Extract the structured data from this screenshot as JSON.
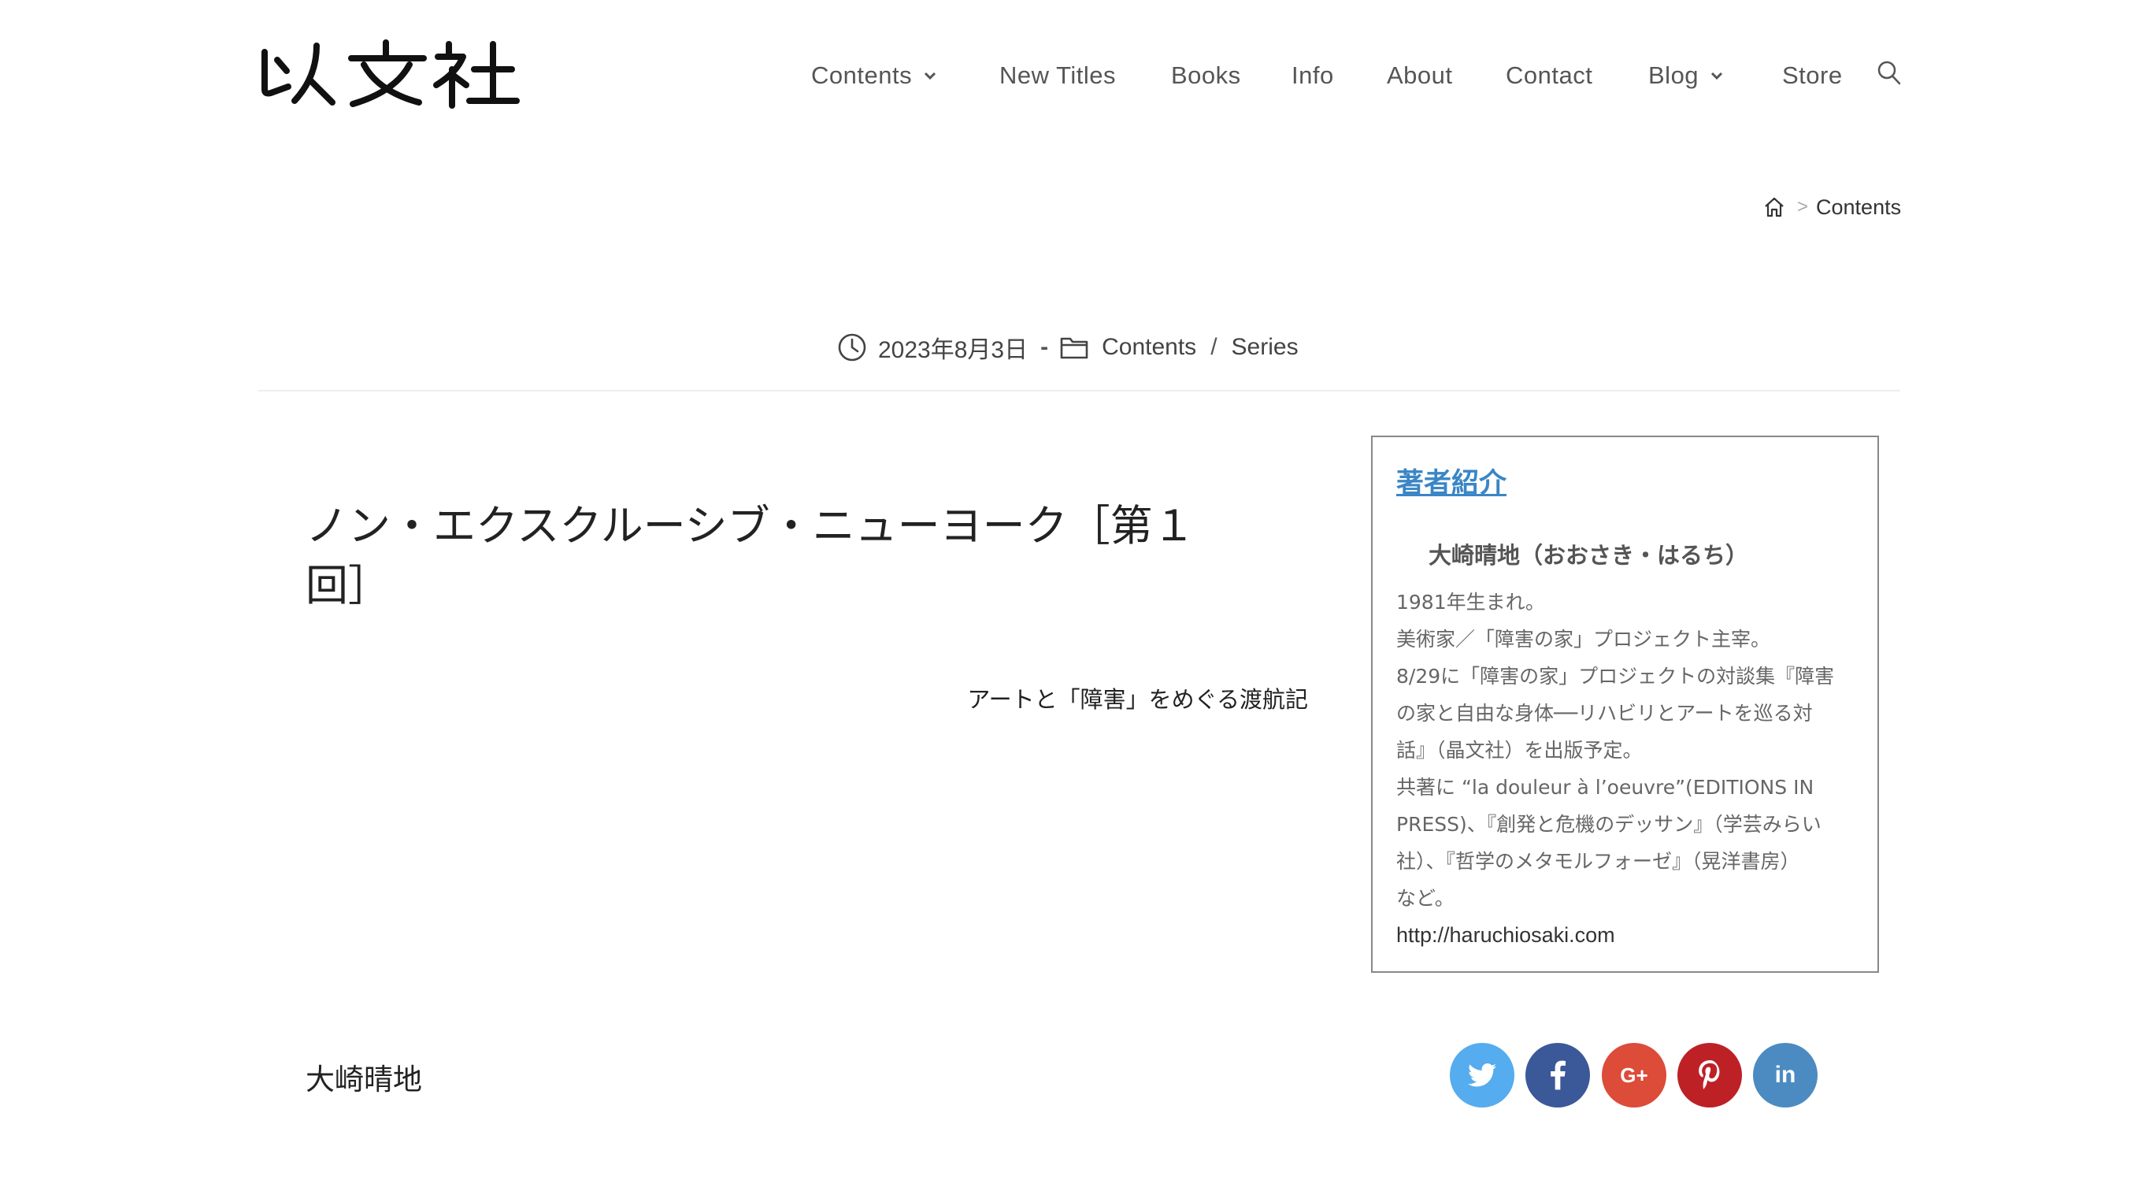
{
  "site": {
    "logo_text": "以文社"
  },
  "nav": {
    "items": [
      {
        "label": "Contents",
        "has_dropdown": true
      },
      {
        "label": "New Titles",
        "has_dropdown": false
      },
      {
        "label": "Books",
        "has_dropdown": false
      },
      {
        "label": "Info",
        "has_dropdown": false
      },
      {
        "label": "About",
        "has_dropdown": false
      },
      {
        "label": "Contact",
        "has_dropdown": false
      },
      {
        "label": "Blog",
        "has_dropdown": true
      },
      {
        "label": "Store",
        "has_dropdown": false
      }
    ],
    "search_icon": "search-icon"
  },
  "breadcrumb": {
    "home_icon": "home-icon",
    "separator": ">",
    "current": "Contents"
  },
  "meta": {
    "date": "2023年8月3日",
    "date_separator": "-",
    "categories": [
      "Contents",
      "Series"
    ],
    "category_separator": "/"
  },
  "article": {
    "title": "ノン・エクスクルーシブ・ニューヨーク［第１回］",
    "subtitle": "アートと「障害」をめぐる渡航記",
    "author": "大崎晴地"
  },
  "profile": {
    "heading": "著者紹介",
    "name": "大崎晴地（おおさき・はるち）",
    "lines": [
      "1981年生まれ。",
      "美術家／「障害の家」プロジェクト主宰。",
      "8/29に「障害の家」プロジェクトの対談集『障害",
      "の家と自由な身体──リハビリとアートを巡る対",
      "話』（晶文社）を出版予定。",
      "共著に “la douleur à l’oeuvre”(EDITIONS IN",
      "PRESS)、『創発と危機のデッサン』（学芸みらい",
      "社）、『哲学のメタモルフォーゼ』（晃洋書房）",
      "など。"
    ],
    "url": "http://haruchiosaki.com"
  },
  "social": [
    {
      "network": "twitter",
      "icon": "twitter-icon",
      "color": "#55acee"
    },
    {
      "network": "facebook",
      "icon": "facebook-icon",
      "color": "#3b5998"
    },
    {
      "network": "google-plus",
      "icon": "google-plus-icon",
      "color": "#dd4b39",
      "glyph": "G+"
    },
    {
      "network": "pinterest",
      "icon": "pinterest-icon",
      "color": "#bd2126"
    },
    {
      "network": "linkedin",
      "icon": "linkedin-icon",
      "color": "#4c8bc2",
      "glyph": "in"
    }
  ],
  "colors": {
    "link_blue": "#3a86c6",
    "nav_text": "#555555",
    "divider": "#eeeeee"
  }
}
